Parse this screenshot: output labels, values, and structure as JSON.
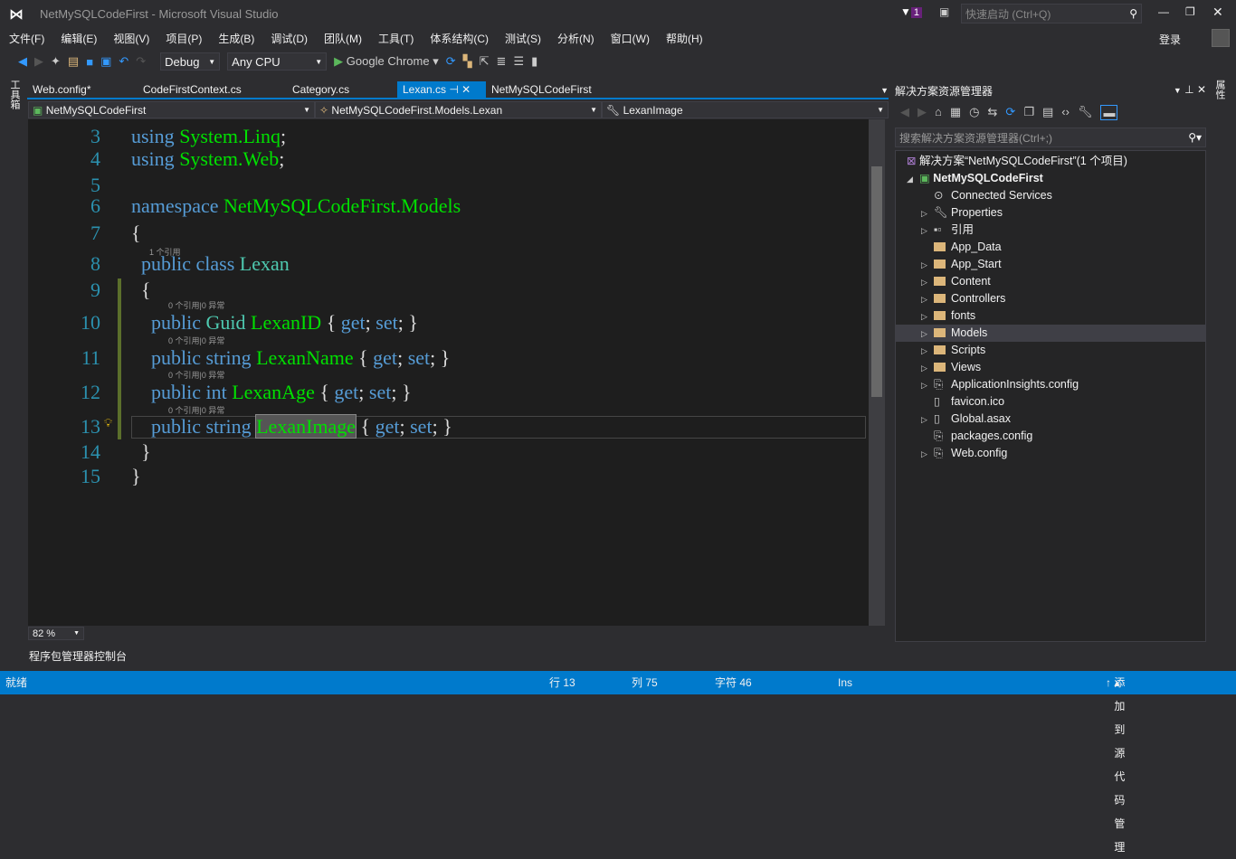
{
  "window": {
    "title": "NetMySQLCodeFirst - Microsoft Visual Studio",
    "quick_launch_placeholder": "快速启动 (Ctrl+Q)",
    "notification_count": "1",
    "login": "登录"
  },
  "menu": [
    "文件(F)",
    "编辑(E)",
    "视图(V)",
    "项目(P)",
    "生成(B)",
    "调试(D)",
    "团队(M)",
    "工具(T)",
    "体系结构(C)",
    "测试(S)",
    "分析(N)",
    "窗口(W)",
    "帮助(H)"
  ],
  "toolbar": {
    "config": "Debug",
    "platform": "Any CPU",
    "run_target": "Google Chrome"
  },
  "left_rail": "工具箱",
  "right_rail": "属性",
  "tabs": [
    "Web.config*",
    "CodeFirstContext.cs",
    "Category.cs",
    "Lexan.cs",
    "NetMySQLCodeFirst"
  ],
  "nav": {
    "project": "NetMySQLCodeFirst",
    "type": "NetMySQLCodeFirst.Models.Lexan",
    "member": "LexanImage"
  },
  "code": {
    "lens_class": "1 个引用",
    "lens_member": "0 个引用|0 异常",
    "lines": [
      "3",
      "4",
      "5",
      "6",
      "7",
      "8",
      "9",
      "10",
      "11",
      "12",
      "13",
      "14",
      "15"
    ]
  },
  "zoom": "82 %",
  "bottom_tab": "程序包管理器控制台",
  "solution_explorer": {
    "title": "解决方案资源管理器",
    "search_placeholder": "搜索解决方案资源管理器(Ctrl+;)",
    "solution": "解决方案“NetMySQLCodeFirst”(1 个项目)",
    "project": "NetMySQLCodeFirst",
    "items": [
      {
        "label": "Connected Services",
        "icon": "connected-services-icon",
        "exp": false
      },
      {
        "label": "Properties",
        "icon": "wrench-icon",
        "exp": true
      },
      {
        "label": "引用",
        "icon": "references-icon",
        "exp": true
      },
      {
        "label": "App_Data",
        "icon": "folder-icon",
        "exp": false
      },
      {
        "label": "App_Start",
        "icon": "folder-icon",
        "exp": true
      },
      {
        "label": "Content",
        "icon": "folder-icon",
        "exp": true
      },
      {
        "label": "Controllers",
        "icon": "folder-icon",
        "exp": true
      },
      {
        "label": "fonts",
        "icon": "folder-icon",
        "exp": true
      },
      {
        "label": "Models",
        "icon": "folder-icon",
        "exp": true,
        "selected": true
      },
      {
        "label": "Scripts",
        "icon": "folder-icon",
        "exp": true
      },
      {
        "label": "Views",
        "icon": "folder-icon",
        "exp": true
      },
      {
        "label": "ApplicationInsights.config",
        "icon": "config-file-icon",
        "exp": true
      },
      {
        "label": "favicon.ico",
        "icon": "file-icon",
        "exp": false
      },
      {
        "label": "Global.asax",
        "icon": "file-icon",
        "exp": true
      },
      {
        "label": "packages.config",
        "icon": "config-file-icon",
        "exp": false
      },
      {
        "label": "Web.config",
        "icon": "config-file-icon",
        "exp": true
      }
    ]
  },
  "status": {
    "ready": "就绪",
    "line": "行 13",
    "col": "列 75",
    "char": "字符 46",
    "mode": "Ins",
    "source_control": "添加到源代码管理"
  },
  "colors": {
    "accent": "#007acc",
    "keyword": "#569cd6",
    "type": "#4ec9b0",
    "identifier": "#00e000"
  }
}
